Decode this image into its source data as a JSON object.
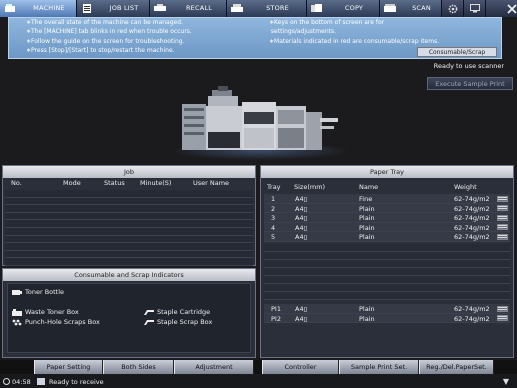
{
  "tabs": [
    {
      "label": "MACHINE",
      "icon": "machine-icon",
      "active": true
    },
    {
      "label": "JOB LIST",
      "icon": "job-list-icon",
      "active": false
    },
    {
      "label": "RECALL",
      "icon": "recall-icon",
      "active": false
    },
    {
      "label": "STORE",
      "icon": "store-icon",
      "active": false
    },
    {
      "label": "COPY",
      "icon": "copy-icon",
      "active": false
    },
    {
      "label": "SCAN",
      "icon": "scan-icon",
      "active": false
    }
  ],
  "info": {
    "left_lines": [
      "∗The overall state of the machine can be managed.",
      "∗The [MACHINE] tab blinks in red when trouble occurs.",
      "∗Follow the guide on the screen for troubleshooting.",
      "∗Press [Stop]/[Start] to stop/restart the machine."
    ],
    "right_lines": [
      "∗Keys on the bottom of screen are for",
      " settings/adjustments.",
      "∗Materials indicated in red are consumable/scrap items."
    ],
    "consumable_button": "Consumable/Scrap",
    "colors": {
      "banner": "#7ea6d2",
      "active_tab": "#7aa0d2"
    }
  },
  "status": {
    "scanner": "Ready to use scanner"
  },
  "sample_print_button": "Execute Sample Print",
  "job_panel": {
    "title": "Job",
    "columns": [
      "No.",
      "Mode",
      "Status",
      "Minute(S)",
      "User Name"
    ]
  },
  "consumables": {
    "title": "Consumable and Scrap Indicators",
    "items": [
      {
        "label": "Toner Bottle",
        "icon": "toner-bottle-icon"
      },
      {
        "label": "Waste Toner Box",
        "icon": "waste-toner-box-icon"
      },
      {
        "label": "Punch-Hole Scraps Box",
        "icon": "punch-hole-scraps-icon"
      },
      {
        "label": "Staple Cartridge",
        "icon": "staple-cartridge-icon"
      },
      {
        "label": "Staple Scrap Box",
        "icon": "staple-scrap-box-icon"
      }
    ]
  },
  "tray_panel": {
    "title": "Paper Tray",
    "columns": [
      "Tray",
      "Size(mm)",
      "Name",
      "Weight"
    ],
    "rows": [
      {
        "tray": "1",
        "size": "A4",
        "name": "Fine",
        "weight": "62-74g/m2"
      },
      {
        "tray": "2",
        "size": "A4",
        "name": "Plain",
        "weight": "62-74g/m2"
      },
      {
        "tray": "3",
        "size": "A4",
        "name": "Plain",
        "weight": "62-74g/m2"
      },
      {
        "tray": "4",
        "size": "A4",
        "name": "Plain",
        "weight": "62-74g/m2"
      },
      {
        "tray": "5",
        "size": "A4",
        "name": "Plain",
        "weight": "62-74g/m2"
      }
    ],
    "pi_rows": [
      {
        "tray": "PI1",
        "size": "A4",
        "name": "Plain",
        "weight": "62-74g/m2"
      },
      {
        "tray": "PI2",
        "size": "A4",
        "name": "Plain",
        "weight": "62-74g/m2"
      }
    ]
  },
  "function_bar": {
    "left": [
      "Paper Setting",
      "Both Sides",
      "Adjustment"
    ],
    "right": [
      "Controller",
      "Sample Print Set.",
      "Reg./Del.PaperSet."
    ]
  },
  "statusbar": {
    "time": "04:58",
    "message": "Ready to receive"
  }
}
